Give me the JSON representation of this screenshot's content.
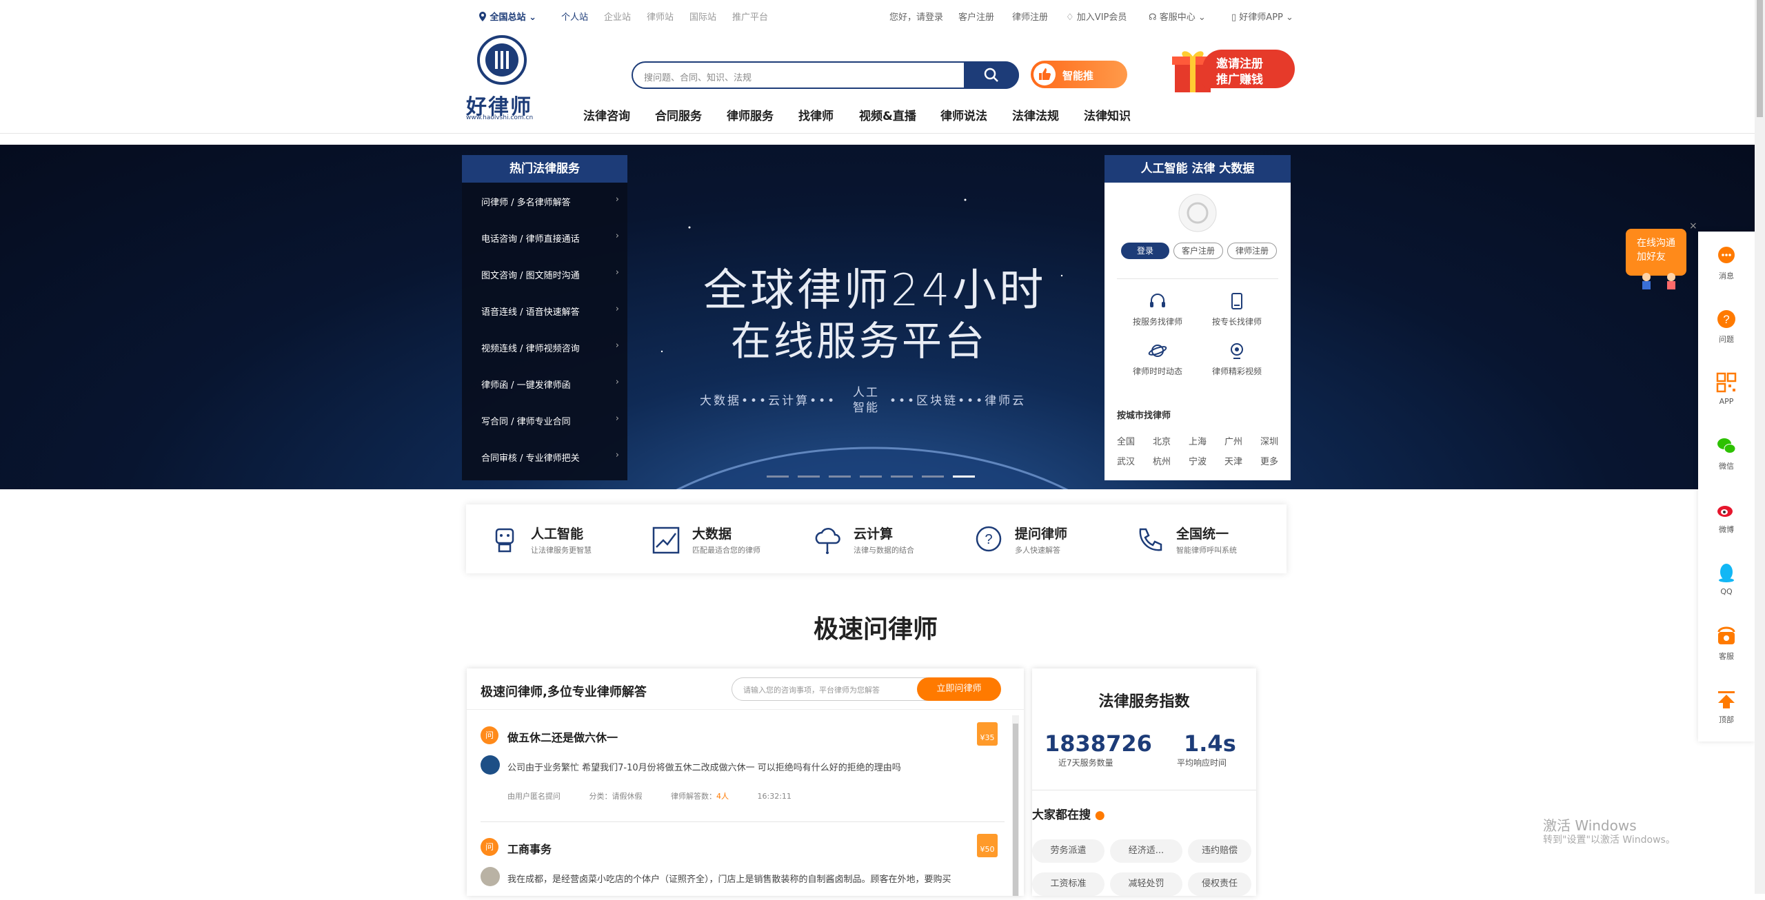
{
  "topbar": {
    "location": "全国总站",
    "sites": [
      "个人站",
      "企业站",
      "律师站",
      "国际站",
      "推广平台"
    ],
    "greeting": "您好，请登录",
    "client_register": "客户注册",
    "lawyer_register": "律师注册",
    "vip": "加入VIP会员",
    "service_center": "客服中心",
    "app": "好律师APP"
  },
  "logo": {
    "name": "好律师",
    "url": "www.haolvshi.com.cn"
  },
  "search": {
    "placeholder": "搜问题、合同、知识、法规",
    "zhineng": "智能推"
  },
  "promo": {
    "line1": "邀请注册",
    "line2": "推广赚钱"
  },
  "nav": [
    "法律咨询",
    "合同服务",
    "律师服务",
    "找律师",
    "视频&直播",
    "律师说法",
    "法律法规",
    "法律知识"
  ],
  "left_menu": {
    "title": "热门法律服务",
    "items": [
      "问律师 / 多名律师解答",
      "电话咨询 / 律师直接通话",
      "图文咨询 / 图文随时沟通",
      "语音连线 / 语音快速解答",
      "视频连线 / 律师视频咨询",
      "律师函 / 一键发律师函",
      "写合同 / 律师专业合同",
      "合同审核 / 专业律师把关"
    ]
  },
  "banner": {
    "line1": "全球律师24小时",
    "line2": "在线服务平台",
    "keywords_left": "大数据•••云计算•••",
    "center_top": "人工",
    "center_bottom": "智能",
    "keywords_right": "•••区块链•••律师云"
  },
  "right_box": {
    "title": "人工智能 法律 大数据",
    "login": "登录",
    "client_register": "客户注册",
    "lawyer_register": "律师注册",
    "functions": [
      "按服务找律师",
      "按专长找律师",
      "律师时时动态",
      "律师精彩视频"
    ],
    "city_title": "按城市找律师",
    "cities": [
      "全国",
      "北京",
      "上海",
      "广州",
      "深圳",
      "武汉",
      "杭州",
      "宁波",
      "天津",
      "更多"
    ]
  },
  "features": [
    {
      "title": "人工智能",
      "sub": "让法律服务更智慧"
    },
    {
      "title": "大数据",
      "sub": "匹配最适合您的律师"
    },
    {
      "title": "云计算",
      "sub": "法律与数据的结合"
    },
    {
      "title": "提问律师",
      "sub": "多人快速解答"
    },
    {
      "title": "全国统一",
      "sub": "智能律师呼叫系统"
    }
  ],
  "section_title": "极速问律师",
  "qa": {
    "header": "极速问律师,多位专业律师解答",
    "input_placeholder": "请输入您的咨询事项，平台律师为您解答",
    "ask_button": "立即问律师",
    "badge": "问",
    "items": [
      {
        "title": "做五休二还是做六休一",
        "content": "公司由于业务繁忙 希望我们7-10月份将做五休二改成做六休一 可以拒绝吗有什么好的拒绝的理由吗",
        "asker": "由用户匿名提问",
        "category": "分类：请假休假",
        "answers_label": "律师解答数：",
        "answers": "4人",
        "time": "16:32:11",
        "reward": "¥35"
      },
      {
        "title": "工商事务",
        "content": "我在成都，是经营卤菜小吃店的个体户（证照齐全），门店上是销售散装称的自制酱卤制品。顾客在外地，要购买",
        "reward": "¥50"
      }
    ]
  },
  "stats": {
    "title": "法律服务指数",
    "count": "1838726",
    "count_label": "近7天服务数量",
    "response": "1.4s",
    "response_label": "平均响应时间",
    "hot_title": "大家都在搜",
    "tags": [
      "劳务派遣",
      "经济适...",
      "违约赔偿",
      "工资标准",
      "减轻处罚",
      "侵权责任"
    ]
  },
  "float_chat": {
    "line1": "在线沟通",
    "line2": "加好友"
  },
  "sidebar": [
    "消息",
    "问题",
    "APP",
    "微信",
    "微博",
    "QQ",
    "客服",
    "顶部"
  ],
  "windows": {
    "line1": "激活 Windows",
    "line2": "转到\"设置\"以激活 Windows。"
  },
  "colors": {
    "brand": "#1d3c78",
    "accent": "#ff7a00"
  }
}
